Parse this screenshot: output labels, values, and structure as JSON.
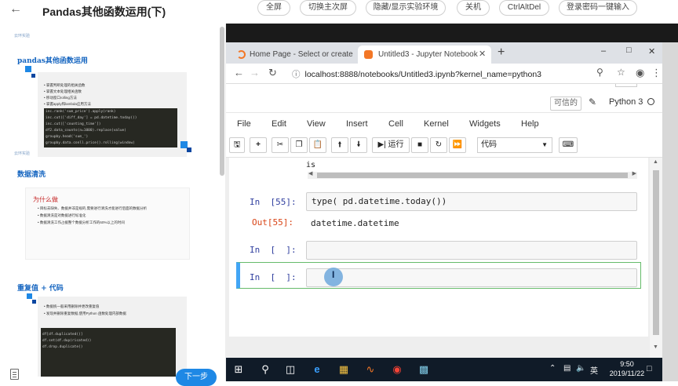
{
  "top_bar": {
    "back_icon": "arrow-left-icon",
    "title": "Pandas其他函数运用(下)",
    "buttons": [
      "全屏",
      "切换主次屏",
      "隐藏/显示实验环境",
      "关机",
      "CtrlAltDel",
      "登录密码一键输入"
    ]
  },
  "slides": {
    "slide1": {
      "logo": "云环实验",
      "title": "pandas其他函数运用",
      "bullets": [
        "掌握判断处理的相关函数",
        "掌握文本处理相关函数",
        "移动窗口rolling方法",
        "掌握apply和lambda应用方法"
      ],
      "code": [
        "inc.rank('sum_price').apply(rank)",
        "inc.cut(['diff_day'] = pd.datetime.today())",
        "inc.cut(['counting_time'])",
        "df2.data_counts(n=1000).replace(value)",
        "groupby.head('sum_')",
        "groupby.data.conll.price().rolling(window)"
      ]
    },
    "slide2": {
      "logo": "云环实验",
      "section": "数据清洗",
      "card_title": "为什么做",
      "bullets": [
        "目标去缺失、数据并非是规的,需要进行清洗才能进行后面的数据分析",
        "数据清洗是对数据进行标准化",
        "数据清洗工作占据整个数据分析工作的60%以上的时间"
      ]
    },
    "slide3": {
      "section": "重复值 + 代码",
      "bullets": [
        "数据统一般采用删除并更改重复值",
        "发现并删除重复数据,使用Python 函数处理内部数据"
      ],
      "code": [
        "df[df.duplicated()]",
        "df.set(df.dup(ricated))",
        "df.drop.duplicate()"
      ]
    },
    "document_icon": "document-icon",
    "next_button": "下一步"
  },
  "browser": {
    "tabs": [
      {
        "label": "Home Page - Select or create",
        "icon": "jupyter-icon"
      },
      {
        "label": "Untitled3 - Jupyter Notebook",
        "icon": "jupyter-notebook-icon"
      }
    ],
    "new_tab": "+",
    "window_controls": [
      "–",
      "□",
      "✕"
    ],
    "url": "localhost:8888/notebooks/Untitled3.ipynb?kernel_name=python3"
  },
  "jupyter": {
    "trusted": "可信的",
    "kernel": "Python 3",
    "menu": [
      "File",
      "Edit",
      "View",
      "Insert",
      "Cell",
      "Kernel",
      "Widgets",
      "Help"
    ],
    "run_label": "运行",
    "cell_type": "代码",
    "output_fragment": "is",
    "cells": [
      {
        "prompt": "In  [55]:",
        "code": "type( pd.datetime.today())",
        "out_prompt": "Out[55]:",
        "output": "datetime.datetime"
      },
      {
        "prompt": "In  [  ]:",
        "code": ""
      },
      {
        "prompt": "In  [  ]:",
        "code": ""
      }
    ]
  },
  "taskbar": {
    "ime": "英",
    "time": "9:50",
    "date": "2019/11/22"
  }
}
